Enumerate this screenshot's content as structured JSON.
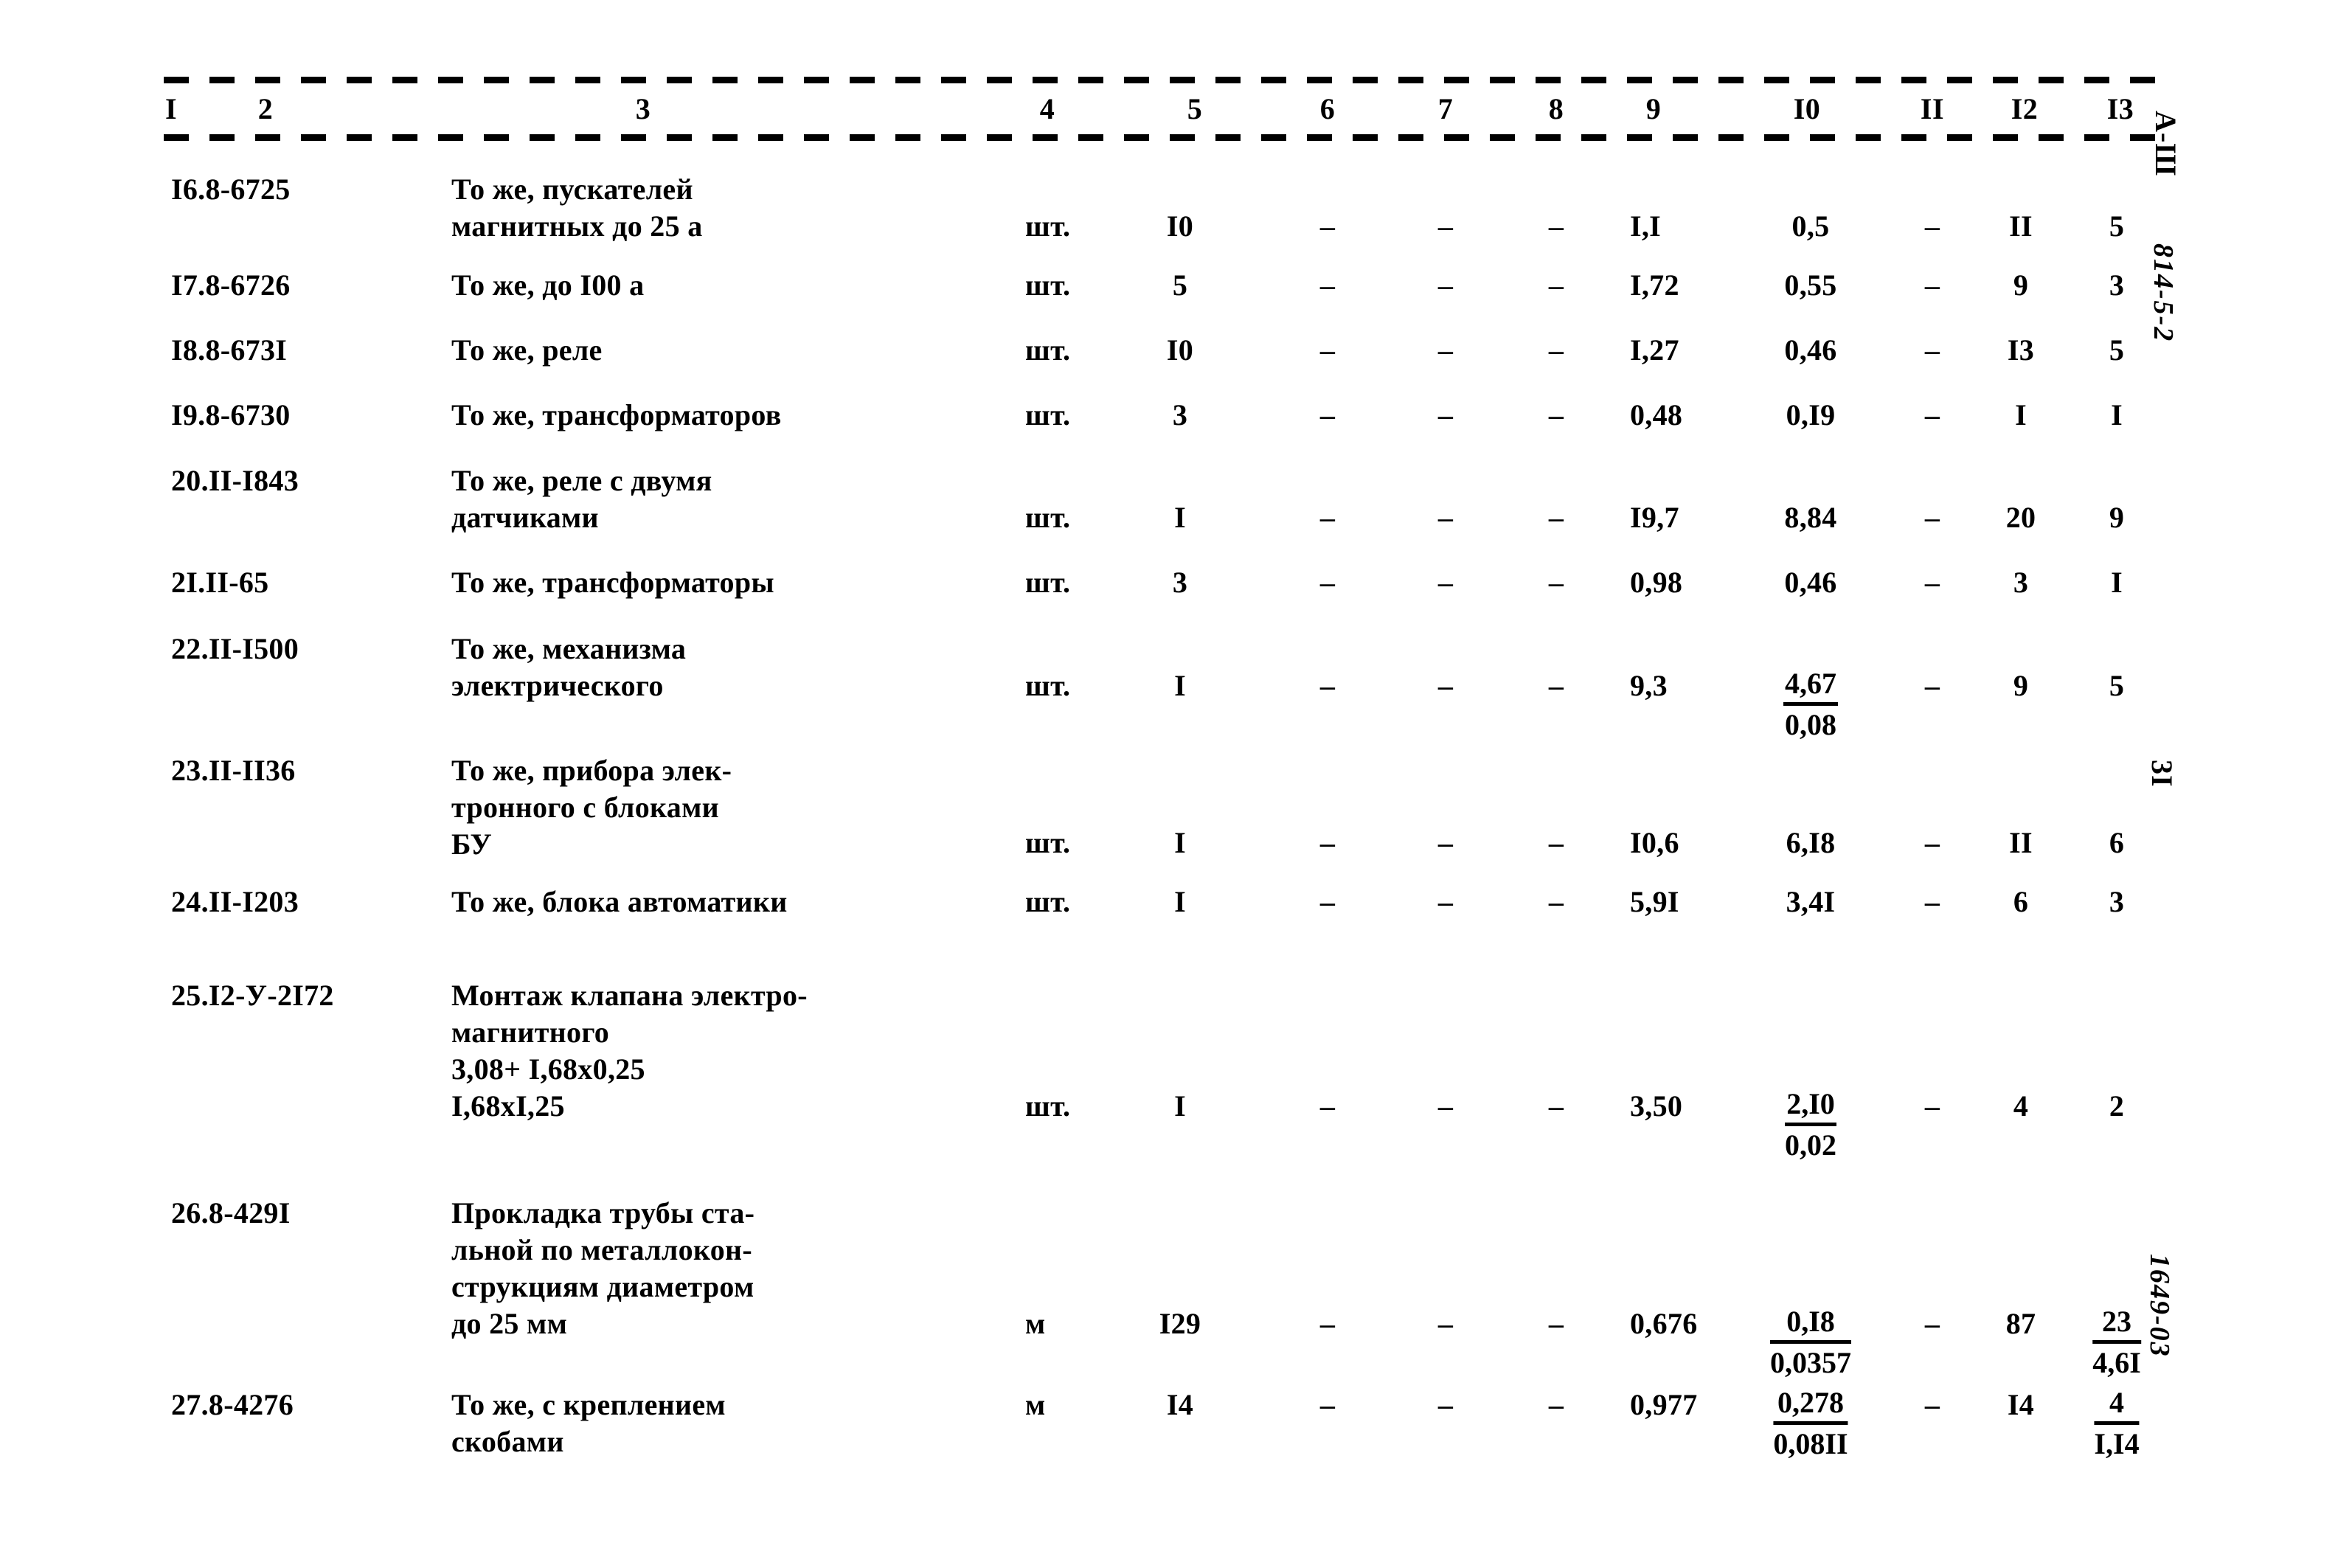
{
  "document": {
    "type": "scanned-estimate-table",
    "page_marker": "3I",
    "header_stamp": "А-Ш",
    "handwritten_top": "814-5-2",
    "handwritten_bottom": "1649-03"
  },
  "table": {
    "column_headers": [
      "I",
      "2",
      "3",
      "4",
      "5",
      "6",
      "7",
      "8",
      "9",
      "I0",
      "II",
      "I2",
      "I3"
    ],
    "rows": [
      {
        "code": "I6.8-6725",
        "description": [
          "То же, пускателей",
          "магнитных до 25 а"
        ],
        "unit": "шт.",
        "qty": "I0",
        "c6": "–",
        "c7": "–",
        "c8": "–",
        "c9": "I,I",
        "c10": "0,5",
        "c10_den": "",
        "c11": "–",
        "c12": "II",
        "c13": "5",
        "c13_den": ""
      },
      {
        "code": "I7.8-6726",
        "description": [
          "То же, до I00 а"
        ],
        "unit": "шт.",
        "qty": "5",
        "c6": "–",
        "c7": "–",
        "c8": "–",
        "c9": "I,72",
        "c10": "0,55",
        "c10_den": "",
        "c11": "–",
        "c12": "9",
        "c13": "3",
        "c13_den": ""
      },
      {
        "code": "I8.8-673I",
        "description": [
          "То же, реле"
        ],
        "unit": "шт.",
        "qty": "I0",
        "c6": "–",
        "c7": "–",
        "c8": "–",
        "c9": "I,27",
        "c10": "0,46",
        "c10_den": "",
        "c11": "–",
        "c12": "I3",
        "c13": "5",
        "c13_den": ""
      },
      {
        "code": "I9.8-6730",
        "description": [
          "То же, трансформаторов"
        ],
        "unit": "шт.",
        "qty": "3",
        "c6": "–",
        "c7": "–",
        "c8": "–",
        "c9": "0,48",
        "c10": "0,I9",
        "c10_den": "",
        "c11": "–",
        "c12": "I",
        "c13": "I",
        "c13_den": ""
      },
      {
        "code": "20.II-I843",
        "description": [
          "То же, реле с двумя",
          "датчиками"
        ],
        "unit": "шт.",
        "qty": "I",
        "c6": "–",
        "c7": "–",
        "c8": "–",
        "c9": "I9,7",
        "c10": "8,84",
        "c10_den": "",
        "c11": "–",
        "c12": "20",
        "c13": "9",
        "c13_den": ""
      },
      {
        "code": "2I.II-65",
        "description": [
          "То же, трансформаторы"
        ],
        "unit": "шт.",
        "qty": "3",
        "c6": "–",
        "c7": "–",
        "c8": "–",
        "c9": "0,98",
        "c10": "0,46",
        "c10_den": "",
        "c11": "–",
        "c12": "3",
        "c13": "I",
        "c13_den": ""
      },
      {
        "code": "22.II-I500",
        "description": [
          "То же, механизма",
          "электрического"
        ],
        "unit": "шт.",
        "qty": "I",
        "c6": "–",
        "c7": "–",
        "c8": "–",
        "c9": "9,3",
        "c10": "4,67",
        "c10_den": "0,08",
        "c11": "–",
        "c12": "9",
        "c13": "5",
        "c13_den": ""
      },
      {
        "code": "23.II-II36",
        "description": [
          "То же, прибора элек-",
          "тронного с блоками",
          "БУ"
        ],
        "unit": "шт.",
        "qty": "I",
        "c6": "–",
        "c7": "–",
        "c8": "–",
        "c9": "I0,6",
        "c10": "6,I8",
        "c10_den": "",
        "c11": "–",
        "c12": "II",
        "c13": "6",
        "c13_den": ""
      },
      {
        "code": "24.II-I203",
        "description": [
          "То же, блока автоматики"
        ],
        "unit": "шт.",
        "qty": "I",
        "c6": "–",
        "c7": "–",
        "c8": "–",
        "c9": "5,9I",
        "c10": "3,4I",
        "c10_den": "",
        "c11": "–",
        "c12": "6",
        "c13": "3",
        "c13_den": ""
      },
      {
        "code": "25.I2-У-2I72",
        "description": [
          "Монтаж клапана электро-",
          "магнитного",
          "3,08+ I,68х0,25",
          "I,68хI,25"
        ],
        "unit": "шт.",
        "qty": "I",
        "c6": "–",
        "c7": "–",
        "c8": "–",
        "c9": "3,50",
        "c10": "2,I0",
        "c10_den": "0,02",
        "c11": "–",
        "c12": "4",
        "c13": "2",
        "c13_den": ""
      },
      {
        "code": "26.8-429I",
        "description": [
          "Прокладка трубы ста-",
          "льной по металлокон-",
          "струкциям диаметром",
          "до 25 мм"
        ],
        "unit": "м",
        "qty": "I29",
        "c6": "–",
        "c7": "–",
        "c8": "–",
        "c9": "0,676",
        "c10": "0,I8",
        "c10_den": "0,0357",
        "c11": "–",
        "c12": "87",
        "c13": "23",
        "c13_den": "4,6I"
      },
      {
        "code": "27.8-4276",
        "description": [
          "То же, с креплением",
          "скобами"
        ],
        "unit": "м",
        "qty": "I4",
        "c6": "–",
        "c7": "–",
        "c8": "–",
        "c9": "0,977",
        "c10": "0,278",
        "c10_den": "0,08II",
        "c11": "–",
        "c12": "I4",
        "c13": "4",
        "c13_den": "I,I4"
      }
    ]
  }
}
